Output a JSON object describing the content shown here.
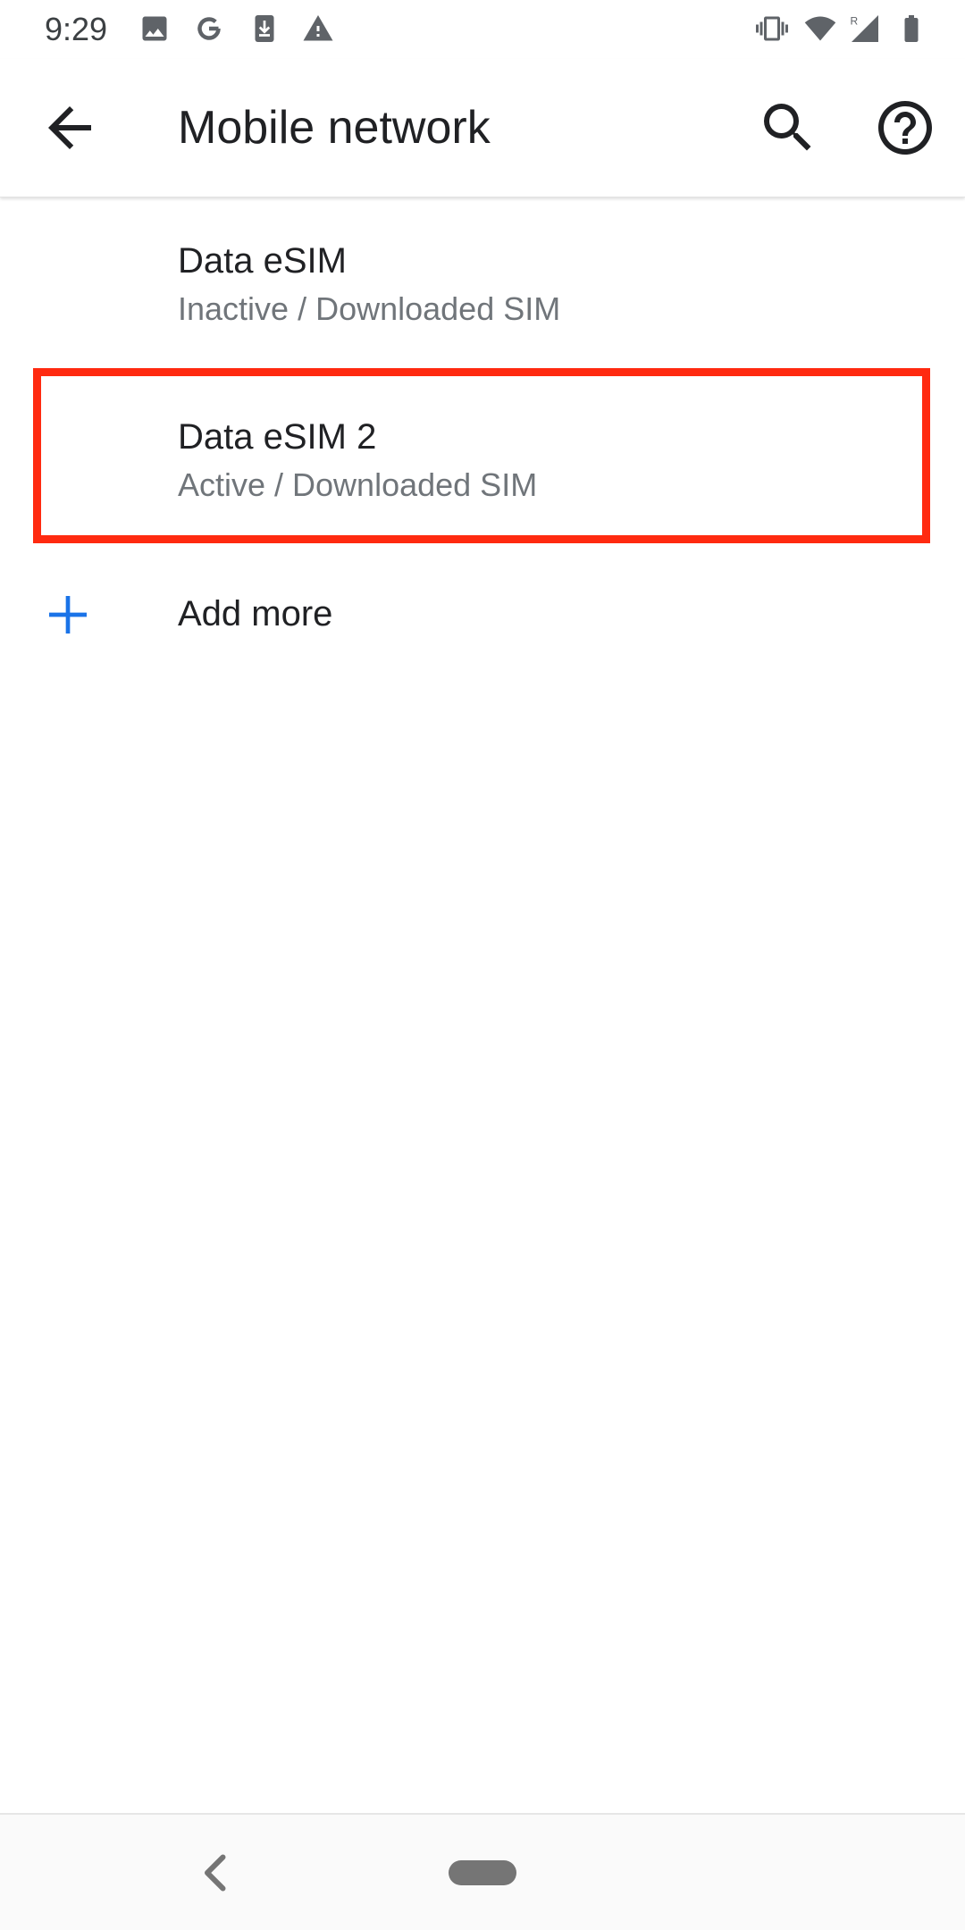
{
  "status_bar": {
    "time": "9:29",
    "left_icons": [
      "image-icon",
      "google-g-icon",
      "download-icon",
      "warning-icon"
    ],
    "right_icons": [
      "vibrate-icon",
      "wifi-icon",
      "signal-roaming-icon",
      "battery-icon"
    ],
    "roaming_label": "R"
  },
  "app_bar": {
    "title": "Mobile network",
    "back_icon": "arrow-back-icon",
    "search_icon": "search-icon",
    "help_icon": "help-icon"
  },
  "sims": [
    {
      "title": "Data eSIM",
      "subtitle": "Inactive / Downloaded SIM"
    },
    {
      "title": "Data eSIM 2",
      "subtitle": "Active / Downloaded SIM",
      "highlighted": true
    }
  ],
  "add_more": {
    "label": "Add more",
    "icon": "plus-icon"
  },
  "nav_bar": {
    "back_icon": "nav-back-icon",
    "home_icon": "home-pill-icon"
  },
  "colors": {
    "accent": "#1a73e8",
    "highlight": "#ff2a10",
    "primary_text": "#202124",
    "secondary_text": "#70757a"
  }
}
